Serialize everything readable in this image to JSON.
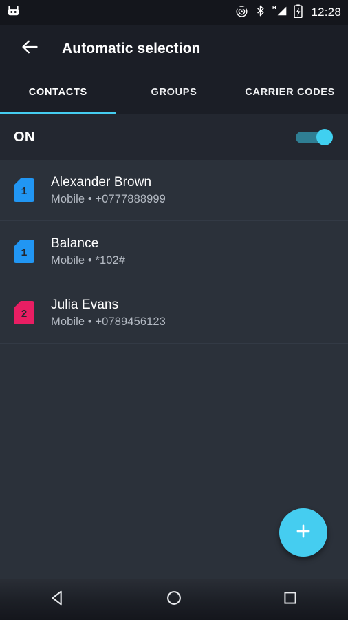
{
  "status_bar": {
    "notification_icon": "android-robot-icon",
    "icons": [
      "cast-icon",
      "bluetooth-icon",
      "signal-h-icon",
      "battery-charging-icon"
    ],
    "signal_label": "H",
    "clock": "12:28"
  },
  "toolbar": {
    "back_icon": "back-arrow-icon",
    "title": "Automatic selection"
  },
  "tabs": {
    "active_index": 0,
    "items": [
      {
        "label": "CONTACTS"
      },
      {
        "label": "GROUPS"
      },
      {
        "label": "CARRIER CODES"
      }
    ],
    "indicator_color": "#45cdf0"
  },
  "toggle": {
    "label": "ON",
    "state": "on",
    "track_color": "#2f7e93",
    "thumb_color": "#40d0f0"
  },
  "contacts": [
    {
      "sim": "1",
      "sim_color": "#2196f3",
      "name": "Alexander Brown",
      "detail": "Mobile • +0777888999"
    },
    {
      "sim": "1",
      "sim_color": "#2196f3",
      "name": "Balance",
      "detail": "Mobile • *102#"
    },
    {
      "sim": "2",
      "sim_color": "#e91e63",
      "name": "Julia Evans",
      "detail": "Mobile • +0789456123"
    }
  ],
  "fab": {
    "icon": "plus-icon",
    "color": "#45cdf0"
  },
  "nav_bar": {
    "back": "back-triangle-icon",
    "home": "home-circle-icon",
    "recents": "recents-square-icon"
  }
}
